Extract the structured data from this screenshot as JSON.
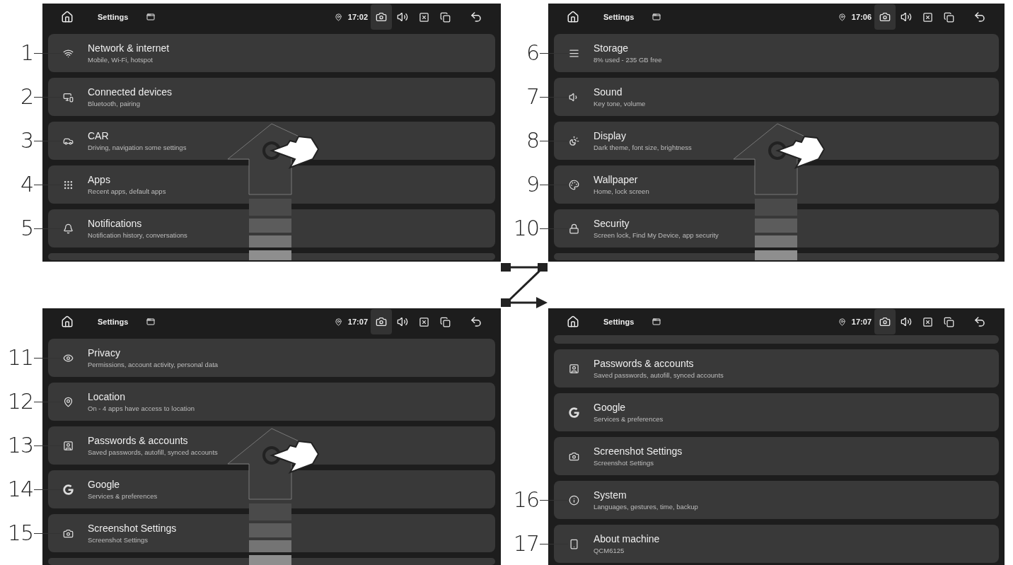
{
  "screens": [
    {
      "title": "Settings",
      "time": "17:02",
      "swipe_hint": true,
      "items": [
        {
          "kind": "entry",
          "callout": "1",
          "title": "Network & internet",
          "subtitle": "Mobile, Wi-Fi, hotspot"
        },
        {
          "kind": "entry",
          "callout": "2",
          "title": "Connected devices",
          "subtitle": "Bluetooth, pairing"
        },
        {
          "kind": "entry",
          "callout": "3",
          "title": "CAR",
          "subtitle": "Driving, navigation some settings"
        },
        {
          "kind": "entry",
          "callout": "4",
          "title": "Apps",
          "subtitle": "Recent apps, default apps"
        },
        {
          "kind": "entry",
          "callout": "5",
          "title": "Notifications",
          "subtitle": "Notification history, conversations"
        },
        {
          "kind": "clipped"
        }
      ]
    },
    {
      "title": "Settings",
      "time": "17:06",
      "swipe_hint": true,
      "items": [
        {
          "kind": "entry",
          "callout": "6",
          "title": "Storage",
          "subtitle": "8% used - 235 GB free"
        },
        {
          "kind": "entry",
          "callout": "7",
          "title": "Sound",
          "subtitle": "Key tone, volume"
        },
        {
          "kind": "entry",
          "callout": "8",
          "title": "Display",
          "subtitle": "Dark theme, font size, brightness"
        },
        {
          "kind": "entry",
          "callout": "9",
          "title": "Wallpaper",
          "subtitle": "Home, lock screen"
        },
        {
          "kind": "entry",
          "callout": "10",
          "title": "Security",
          "subtitle": "Screen lock, Find My Device, app security"
        },
        {
          "kind": "clipped"
        }
      ]
    },
    {
      "title": "Settings",
      "time": "17:07",
      "swipe_hint": true,
      "items": [
        {
          "kind": "entry",
          "callout": "11",
          "title": "Privacy",
          "subtitle": "Permissions, account activity, personal data"
        },
        {
          "kind": "entry",
          "callout": "12",
          "title": "Location",
          "subtitle": "On - 4 apps have access to location"
        },
        {
          "kind": "entry",
          "callout": "13",
          "title": "Passwords & accounts",
          "subtitle": "Saved passwords, autofill, synced accounts"
        },
        {
          "kind": "entry",
          "callout": "14",
          "title": "Google",
          "subtitle": "Services & preferences"
        },
        {
          "kind": "entry",
          "callout": "15",
          "title": "Screenshot Settings",
          "subtitle": "Screenshot Settings"
        },
        {
          "kind": "clipped"
        }
      ]
    },
    {
      "title": "Settings",
      "time": "17:07",
      "swipe_hint": false,
      "items": [
        {
          "kind": "clipped"
        },
        {
          "kind": "entry",
          "title": "Passwords & accounts",
          "subtitle": "Saved passwords, autofill, synced accounts"
        },
        {
          "kind": "entry",
          "title": "Google",
          "subtitle": "Services & preferences"
        },
        {
          "kind": "entry",
          "title": "Screenshot Settings",
          "subtitle": "Screenshot Settings"
        },
        {
          "kind": "entry",
          "callout": "16",
          "title": "System",
          "subtitle": "Languages, gestures, time, backup"
        },
        {
          "kind": "entry",
          "callout": "17",
          "title": "About machine",
          "subtitle": "QCM6125"
        }
      ]
    }
  ]
}
